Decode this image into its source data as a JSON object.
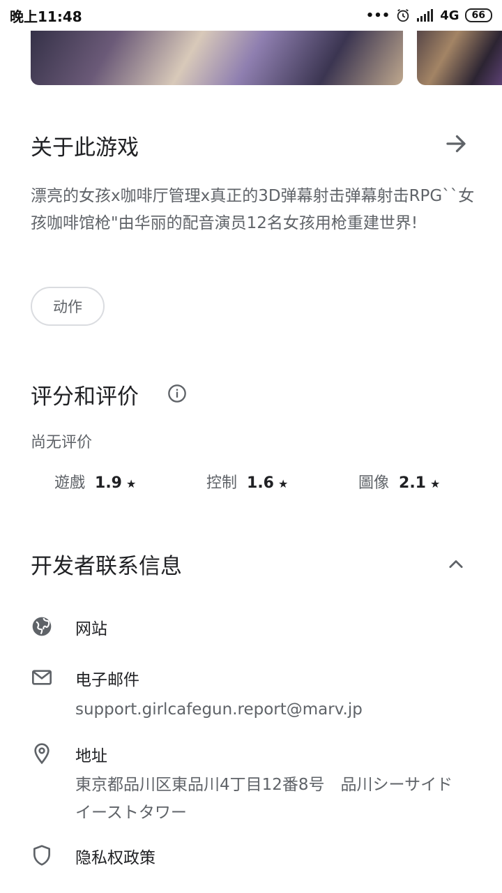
{
  "status_bar": {
    "time": "晚上11:48",
    "dots": "•••",
    "network": "4G",
    "battery": "66"
  },
  "about": {
    "title": "关于此游戏",
    "description": "漂亮的女孩x咖啡厅管理x真正的3D弹幕射击弹幕射击RPG``女孩咖啡馆枪\"由华丽的配音演员12名女孩用枪重建世界!",
    "tag": "动作"
  },
  "ratings": {
    "title": "评分和评价",
    "no_ratings": "尚无评价",
    "items": [
      {
        "label": "遊戲",
        "value": "1.9",
        "star": "★"
      },
      {
        "label": "控制",
        "value": "1.6",
        "star": "★"
      },
      {
        "label": "圖像",
        "value": "2.1",
        "star": "★"
      }
    ]
  },
  "developer": {
    "title": "开发者联系信息",
    "website_label": "网站",
    "email_label": "电子邮件",
    "email_value": "support.girlcafegun.report@marv.jp",
    "address_label": "地址",
    "address_value": "東京都品川区東品川4丁目12番8号　品川シーサイドイーストタワー",
    "privacy_label": "隐私权政策"
  },
  "colors": {
    "primary_text": "#202124",
    "secondary_text": "#5f6368",
    "chip_border": "#dadce0"
  }
}
